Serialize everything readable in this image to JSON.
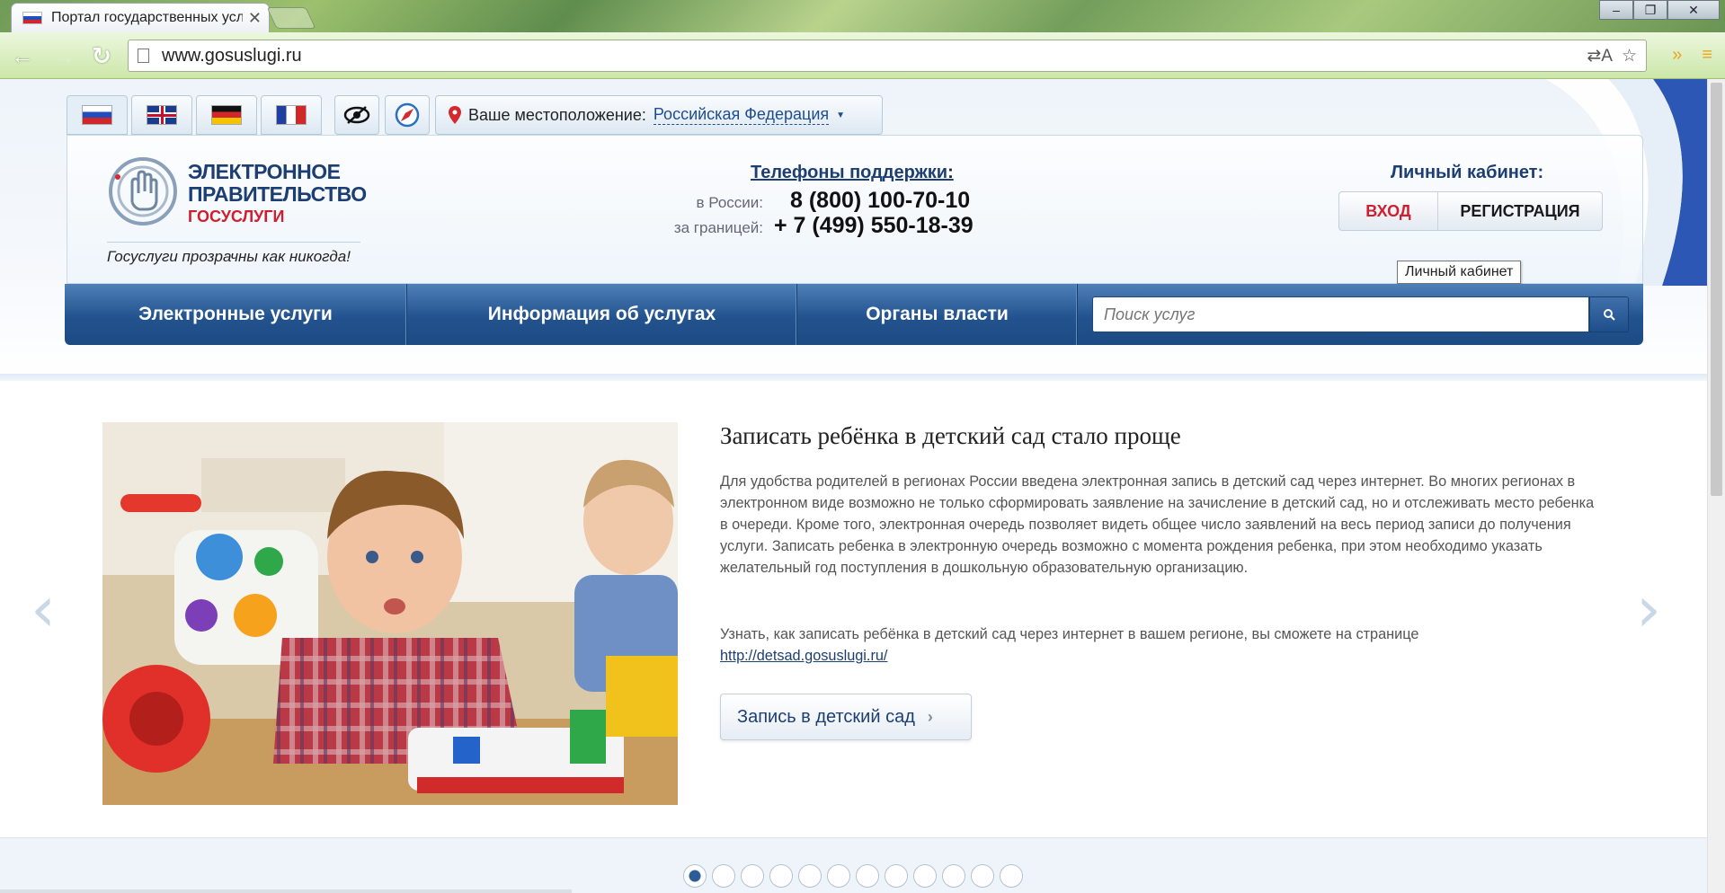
{
  "browser": {
    "tab_title": "Портал государственных услуг",
    "tab_close": "✕",
    "url": "www.gosuslugi.ru",
    "win_minimize": "‒",
    "win_restore": "❐",
    "win_close": "✕"
  },
  "page": {
    "languages": [
      "ru",
      "en",
      "de",
      "fr"
    ],
    "location_label": "Ваше местоположение:",
    "location_value": "Российская Федерация",
    "logo": {
      "line1": "ЭЛЕКТРОННОЕ",
      "line2": "ПРАВИТЕЛЬСТВО",
      "line3": "ГОСУСЛУГИ",
      "slogan": "Госуслуги прозрачны как никогда!"
    },
    "phones": {
      "title": "Телефоны поддержки",
      "colon": ":",
      "russia_label": "в России:",
      "russia_number": "8 (800) 100-70-10",
      "abroad_label": "за границей:",
      "abroad_number": "+ 7 (499) 550-18-39"
    },
    "cabinet": {
      "title": "Личный кабинет:",
      "login": "ВХОД",
      "register": "РЕГИСТРАЦИЯ",
      "tooltip": "Личный кабинет"
    },
    "nav": {
      "items": [
        "Электронные услуги",
        "Информация об услугах",
        "Органы власти"
      ],
      "search_placeholder": "Поиск услуг"
    },
    "slide": {
      "title": "Записать ребёнка в детский сад стало проще",
      "text": "Для удобства родителей в регионах России введена электронная запись в детский сад через интернет. Во многих регионах в электронном виде возможно не только сформировать заявление на зачисление в детский сад, но и отслеживать место ребенка в очереди. Кроме того, электронная очередь позволяет видеть общее число заявлений на весь период записи до получения услуги. Записать ребенка в электронную очередь возможно с момента рождения ребенка, при этом необходимо указать желательный год поступления в дошкольную образовательную организацию.",
      "text2": "Узнать, как записать ребёнка в детский сад через интернет в вашем регионе, вы сможете на странице",
      "link": "http://detsad.gosuslugi.ru/",
      "cta": "Запись в детский сад"
    },
    "pager": {
      "count": 12,
      "active": 1
    },
    "colors": {
      "brand_blue": "#1d3e72",
      "brand_red": "#cf1f2e",
      "nav_blue": "#23538e"
    }
  }
}
